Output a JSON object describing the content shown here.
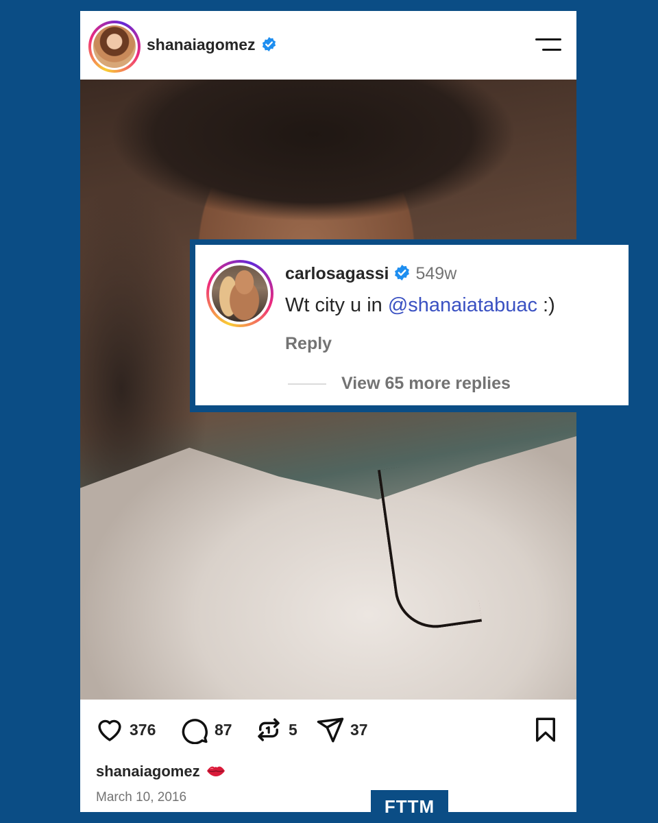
{
  "post": {
    "username": "shanaiagomez",
    "verified": true,
    "likes": "376",
    "comments": "87",
    "reposts": "5",
    "shares": "37",
    "caption_user": "shanaiagomez",
    "caption_emoji": "lips-kiss-emoji",
    "date": "March 10, 2016"
  },
  "comment": {
    "username": "carlosagassi",
    "verified": true,
    "time": "549w",
    "text_prefix": "Wt city u in ",
    "mention": "@shanaiatabuac",
    "text_suffix": " :)",
    "reply_label": "Reply",
    "more_replies": "View 65 more replies"
  },
  "brand": {
    "label": "FTTM"
  },
  "colors": {
    "background": "#0b4d85",
    "verified": "#1e8ef0",
    "mention": "#3a51c2",
    "muted_text": "#737373"
  },
  "icons": [
    "verified-badge-icon",
    "menu-icon",
    "heart-icon",
    "comment-icon",
    "repost-icon",
    "share-icon",
    "bookmark-icon"
  ]
}
